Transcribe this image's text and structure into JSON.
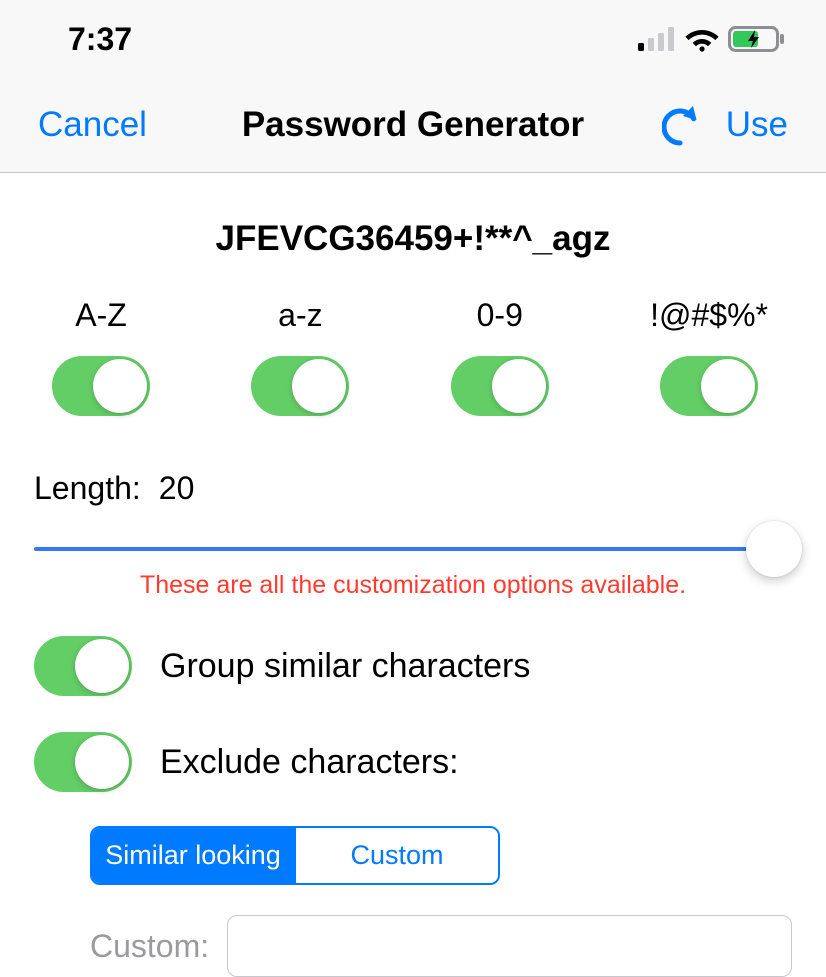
{
  "status": {
    "time": "7:37"
  },
  "nav": {
    "cancel_label": "Cancel",
    "title": "Password Generator",
    "use_label": "Use"
  },
  "password": {
    "display": "JFEVCG36459+!**^_agz"
  },
  "charsets": [
    {
      "label": "A-Z",
      "on": true,
      "name": "uppercase"
    },
    {
      "label": "a-z",
      "on": true,
      "name": "lowercase"
    },
    {
      "label": "0-9",
      "on": true,
      "name": "digits"
    },
    {
      "label": "!@#$%*",
      "on": true,
      "name": "symbols"
    }
  ],
  "length": {
    "label": "Length:",
    "value": "20"
  },
  "hint": "These are all the customization options available.",
  "options": {
    "group_label": "Group similar characters",
    "exclude_label": "Exclude characters:"
  },
  "segmented": {
    "similar_label": "Similar looking",
    "custom_label": "Custom",
    "selected": "similar"
  },
  "custom": {
    "label": "Custom:",
    "value": "",
    "placeholder": ""
  }
}
